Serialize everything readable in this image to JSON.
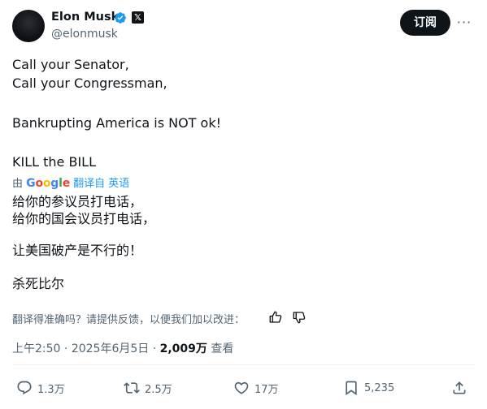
{
  "author": {
    "name": "Elon Musk",
    "handle": "@elonmusk",
    "verified_icon": "verified-badge-icon",
    "affiliate_icon": "x-logo-icon",
    "affiliate_letter": "𝕏"
  },
  "header": {
    "subscribe_label": "订阅",
    "more_label": "···"
  },
  "tweet": {
    "lines": [
      "Call your Senator,",
      "Call your Congressman,",
      "Bankrupting America is NOT ok!",
      "KILL the BILL"
    ]
  },
  "translation": {
    "by_label": "由",
    "provider": "Google",
    "link_label": "翻译自 英语",
    "lines": [
      "给你的参议员打电话，",
      "给你的国会议员打电话，",
      "让美国破产是不行的！",
      "杀死比尔"
    ],
    "feedback_prompt": "翻译得准确吗？请提供反馈，以便我们加以改进："
  },
  "meta": {
    "time": "上午2:50",
    "date": "2025年6月5日",
    "views_count": "2,009万",
    "views_label": "查看",
    "separator": "·"
  },
  "actions": {
    "replies": "1.3万",
    "reposts": "2.5万",
    "likes": "17万",
    "bookmarks": "5,235"
  },
  "colors": {
    "text": "#0f1419",
    "secondary": "#536471",
    "link": "#1d9bf0",
    "verified": "#1d9bf0",
    "button": "#0f1419"
  }
}
